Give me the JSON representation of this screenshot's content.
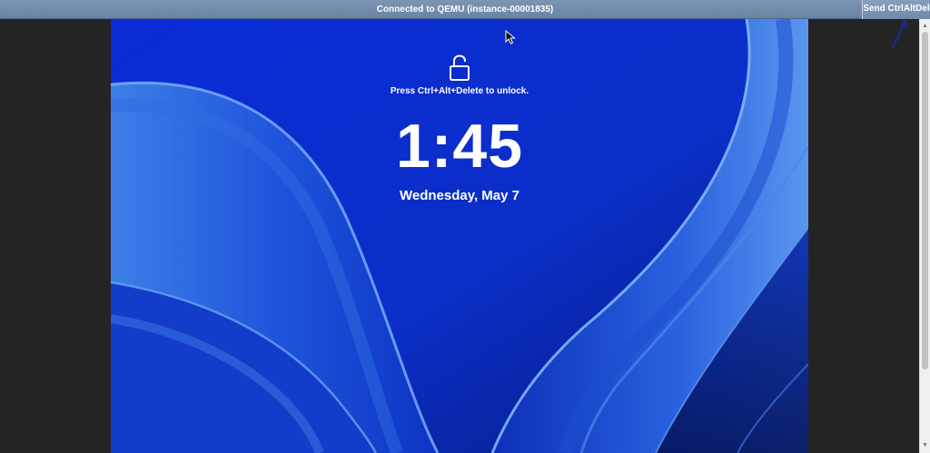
{
  "topbar": {
    "status": "Connected to QEMU (instance-00001835)",
    "send_button_label": "Send CtrlAltDel"
  },
  "lockscreen": {
    "unlock_hint": "Press Ctrl+Alt+Delete to unlock.",
    "time": "1:45",
    "date": "Wednesday, May 7"
  },
  "icons": {
    "lock": "unlock-padlock-icon",
    "cursor": "mouse-pointer-icon",
    "annotation": "arrow-annotation-icon"
  },
  "colors": {
    "topbar": "#7089aa",
    "wallpaper_base": "#0b2bd4",
    "wallpaper_light": "#4d8ae6",
    "frame": "#242424"
  }
}
